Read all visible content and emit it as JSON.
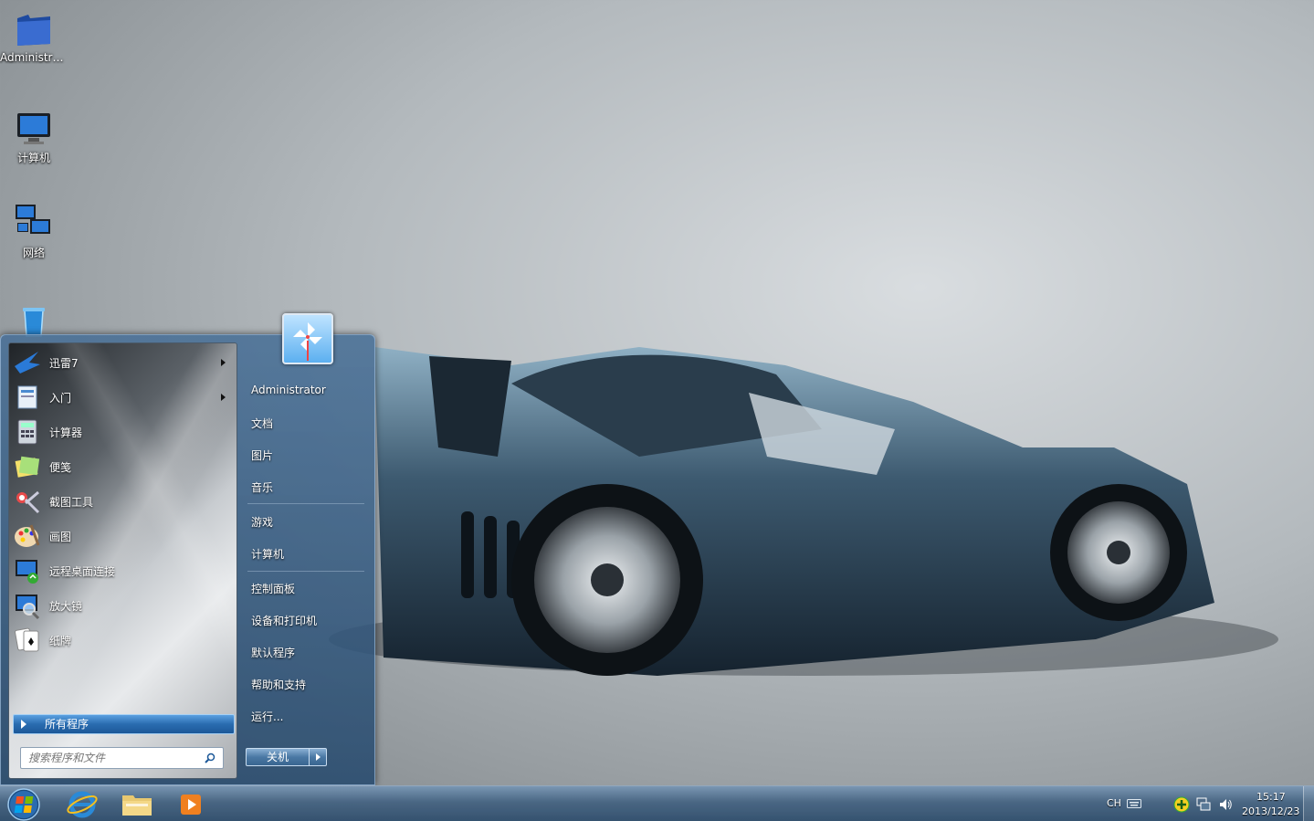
{
  "desktop": {
    "icons": [
      {
        "label": "Administra..."
      },
      {
        "label": "计算机"
      },
      {
        "label": "网络"
      }
    ]
  },
  "start_menu": {
    "programs": [
      {
        "label": "迅雷7",
        "has_submenu": true
      },
      {
        "label": "入门",
        "has_submenu": true
      },
      {
        "label": "计算器",
        "has_submenu": false
      },
      {
        "label": "便笺",
        "has_submenu": false
      },
      {
        "label": "截图工具",
        "has_submenu": false
      },
      {
        "label": "画图",
        "has_submenu": false
      },
      {
        "label": "远程桌面连接",
        "has_submenu": false
      },
      {
        "label": "放大镜",
        "has_submenu": false
      },
      {
        "label": "纸牌",
        "has_submenu": false
      }
    ],
    "all_programs_label": "所有程序",
    "search_placeholder": "搜索程序和文件",
    "right_links": [
      "Administrator",
      "文档",
      "图片",
      "音乐",
      "游戏",
      "计算机",
      "控制面板",
      "设备和打印机",
      "默认程序",
      "帮助和支持",
      "运行..."
    ],
    "shutdown_label": "关机"
  },
  "taskbar": {
    "language": "CH",
    "time": "15:17",
    "date": "2013/12/23"
  },
  "colors": {
    "highlight": "#2a6cb0",
    "taskbar": "#46648a"
  }
}
